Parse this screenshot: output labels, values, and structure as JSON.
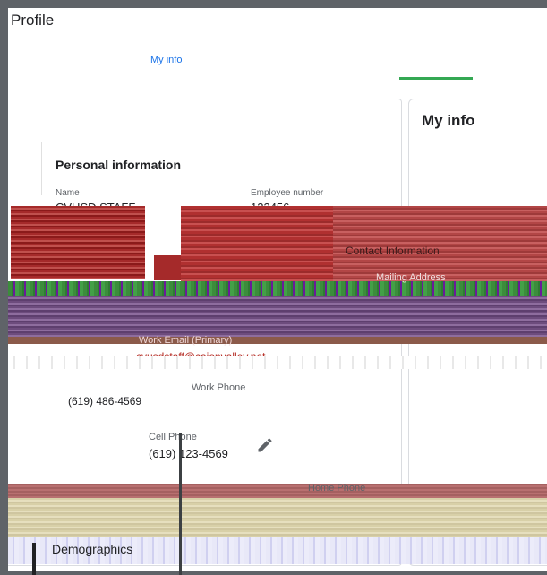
{
  "page": {
    "title": "Profile"
  },
  "tabs": [
    {
      "label": "My info",
      "active": true
    }
  ],
  "my_info_card": {
    "title": "My info"
  },
  "personal_information": {
    "heading": "Personal information",
    "name_label": "Name",
    "name_value": "CVUSD STAFF",
    "employee_number_label": "Employee number",
    "employee_number_value": "123456"
  },
  "contact_information": {
    "heading": "Contact Information",
    "mailing_address_label": "Mailing Address",
    "work_email_label": "Work Email (Primary)",
    "work_email_value": "cvusdstaff@cajonvalley.net",
    "work_phone_label": "Work Phone",
    "work_phone_value": "(619) 486-4569",
    "cell_phone_label": "Cell Phone",
    "cell_phone_value": "(619) 123-4569",
    "home_phone_label": "Home Phone"
  },
  "demographics": {
    "heading": "Demographics"
  },
  "icons": {
    "edit": "pencil-icon"
  },
  "colors": {
    "accent": "#1a73e8",
    "tab_indicator": "#34a853",
    "frame": "#5f6368"
  }
}
